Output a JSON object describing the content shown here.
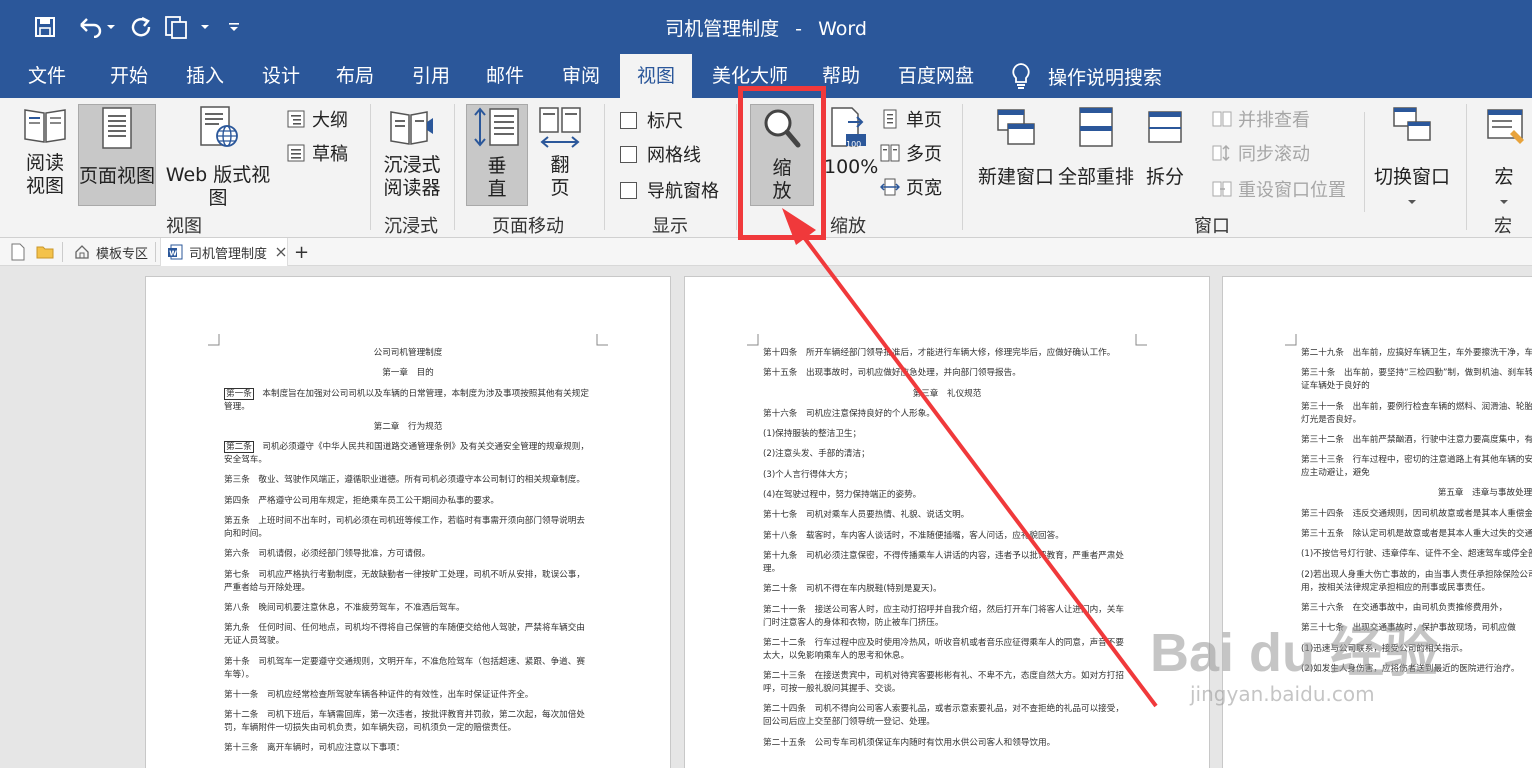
{
  "app": {
    "doc_title": "司机管理制度",
    "separator": "-",
    "app_name": "Word",
    "colors": {
      "title_bar": "#2b579a",
      "ribbon": "#f3f3f3",
      "highlight": "#f0393b"
    }
  },
  "quick_access": {
    "icons": [
      "save-icon",
      "undo-icon",
      "redo-icon",
      "new-document-icon",
      "customize-icon"
    ]
  },
  "menu": {
    "tabs": [
      {
        "label": "文件"
      },
      {
        "label": "开始"
      },
      {
        "label": "插入"
      },
      {
        "label": "设计"
      },
      {
        "label": "布局"
      },
      {
        "label": "引用"
      },
      {
        "label": "邮件"
      },
      {
        "label": "审阅"
      },
      {
        "label": "视图",
        "active": true
      },
      {
        "label": "美化大师"
      },
      {
        "label": "帮助"
      },
      {
        "label": "百度网盘"
      }
    ],
    "tell_me": "操作说明搜索"
  },
  "ribbon": {
    "views": {
      "read_mode_line1": "阅读",
      "read_mode_line2": "视图",
      "print_layout": "页面视图",
      "web_layout": "Web 版式视图",
      "outline": "大纲",
      "draft": "草稿",
      "group": "视图"
    },
    "immersive": {
      "reader_line1": "沉浸式",
      "reader_line2": "阅读器",
      "group": "沉浸式"
    },
    "page_move": {
      "vertical_line1": "垂",
      "vertical_line2": "直",
      "side_line1": "翻",
      "side_line2": "页",
      "group": "页面移动"
    },
    "show": {
      "ruler": "标尺",
      "gridlines": "网格线",
      "navigation": "导航窗格",
      "group": "显示"
    },
    "zoom": {
      "zoom_line1": "缩",
      "zoom_line2": "放",
      "hundred_badge": "100",
      "hundred": "100%",
      "one_page": "单页",
      "multi_page": "多页",
      "page_width": "页宽",
      "group": "缩放"
    },
    "window": {
      "new_window": "新建窗口",
      "arrange_all": "全部重排",
      "split": "拆分",
      "side_by_side": "并排查看",
      "sync_scroll": "同步滚动",
      "reset_position": "重设窗口位置",
      "switch_windows": "切换窗口",
      "group": "窗口"
    },
    "macros": {
      "macros": "宏",
      "group": "宏"
    }
  },
  "doc_tabs": {
    "template": "模板专区",
    "document": "司机管理制度",
    "add": "+"
  },
  "pages": {
    "p1": {
      "title": "公司司机管理制度",
      "ch1": "第一章　目的",
      "a1_label": "第一条",
      "a1": "　本制度旨在加强对公司司机以及车辆的日常管理，本制度为涉及事项按照其他有关规定管理。",
      "ch2": "第二章　行为规范",
      "a2_label": "第二条",
      "a2": "　司机必须遵守《中华人民共和国道路交通管理条例》及有关交通安全管理的规章规则，安全驾车。",
      "a3": "第三条　敬业、驾驶作风端正，遵循职业道德。所有司机必须遵守本公司制订的相关规章制度。",
      "a4": "第四条　严格遵守公司用车规定，拒绝乘车员工公干期间办私事的要求。",
      "a5": "第五条　上班时间不出车时，司机必须在司机班等候工作，若临时有事需开须向部门领导说明去向和时间。",
      "a6": "第六条　司机请假，必须经部门领导批准，方可请假。",
      "a7": "第七条　司机应严格执行考勤制度，无故缺勤者一律按旷工处理，司机不听从安排，耽误公事，严重者给与开除处理。",
      "a8": "第八条　晚间司机要注意休息，不准疲劳驾车，不准酒后驾车。",
      "a9": "第九条　任何时间、任何地点，司机均不得将自己保管的车随便交给他人驾驶，严禁将车辆交由无证人员驾驶。",
      "a10": "第十条　司机驾车一定要遵守交通规则，文明开车，不准危险驾车（包括超速、紧跟、争道、赛车等）。",
      "a11": "第十一条　司机应经常检查所驾驶车辆各种证件的有效性，出车时保证证件齐全。",
      "a12": "第十二条　司机下班后，车辆需回库，第一次违者，按批评教育并罚款，第二次起，每次加倍处罚，车辆附件一切损失由司机负责，如车辆失窃，司机须负一定的赔偿责任。",
      "a13": "第十三条　离开车辆时，司机应注意以下事项："
    },
    "p2": {
      "a14": "第十四条　所开车辆经部门领导批准后，才能进行车辆大修，修理完毕后，应做好确认工作。",
      "a15": "第十五条　出现事故时，司机应做好应急处理，并向部门领导报告。",
      "ch3": "第三章　礼仪规范",
      "a16": "第十六条　司机应注意保持良好的个人形象。",
      "i1": "(1)保持服装的整洁卫生；",
      "i2": "(2)注意头发、手部的清洁；",
      "i3": "(3)个人言行得体大方；",
      "i4": "(4)在驾驶过程中，努力保持端正的姿势。",
      "a17": "第十七条　司机对乘车人员要热情、礼貌、说话文明。",
      "a18": "第十八条　载客时，车内客人谈话时，不准随便插嘴，客人问话，应礼貌回答。",
      "a19": "第十九条　司机必须注意保密，不得传播乘车人讲话的内容，违者予以批评教育，严重者严肃处理。",
      "a20": "第二十条　司机不得在车内脱鞋(特别是夏天)。",
      "a21": "第二十一条　接送公司客人时，应主动打招呼并自我介绍，然后打开车门将客人让进门内，关车门时注意客人的身体和衣物，防止被车门挤压。",
      "a22": "第二十二条　行车过程中应及时使用冷热风，听收音机或者音乐应征得乘车人的同意，声音不要太大，以免影响乘车人的思考和休息。",
      "a23": "第二十三条　在接送贵宾中，司机对待宾客要彬彬有礼、不卑不亢，态度自然大方。如对方打招呼，可按一般礼貌问其握手、交谈。",
      "a24": "第二十四条　司机不得向公司客人索要礼品，或者示意索要礼品，对不查拒绝的礼品可以接受，回公司后应上交至部门领导统一登记、处理。",
      "a25": "第二十五条　公司专车司机须保证车内随时有饮用水供公司客人和领导饮用。"
    },
    "p3": {
      "a29": "第二十九条　出车前，应搞好车辆卫生，车外要擦洗干净，车内清美观。",
      "a30": "第三十条　出车前，要坚持“三检四勤”制，做到机油、刹车转向、喇叭、灯光的安全、可靠，保证车辆处于良好的",
      "a31": "第三十一条　出车前，要例行检查车辆的燃料、润滑油、轮胎气压和轮胎紧固情况，检查喇叭、灯光是否良好。",
      "a32": "第三十二条　出车前严禁酗酒，行驶中注意力要高度集中，有其他有碍驾驶的动作。",
      "a33": "第三十三条　行车过程中，密切的注意道路上有其他车辆的安全距离。遇到对方车辆违章行驶，应主动避让，避免",
      "ch5": "第五章　违章与事故处理",
      "a34": "第三十四条　违反交通规则，因司机故意或者是其本人重偿金额全部由当事人承担。",
      "a35": "第三十五条　除认定司机是故意或者是其本人重大过失的交通事故时，其处理办法如下：",
      "i1": "(1)不按信号灯行驶、违章停车、证件不全、超速驾车或停全部费用。",
      "i2": "(2)若出现人身重大伤亡事故的，由当事人责任承担除保险公司赔偿范围之外，当事人应负责损费用，按相关法律规定承担相应的刑事或民事责任。",
      "a36": "第三十六条　在交通事故中，由司机负责推修费用外，",
      "a37": "第三十七条　出现交通事故时，保护事故现场，司机应做",
      "j1": "(1)迅速与公司联系，接受公司的相关指示。",
      "j2": "(2)如发生人身伤害，应将伤者送到最近的医院进行治疗。"
    }
  },
  "watermark": {
    "brand": "Bai du 经验",
    "url": "jingyan.baidu.com"
  }
}
